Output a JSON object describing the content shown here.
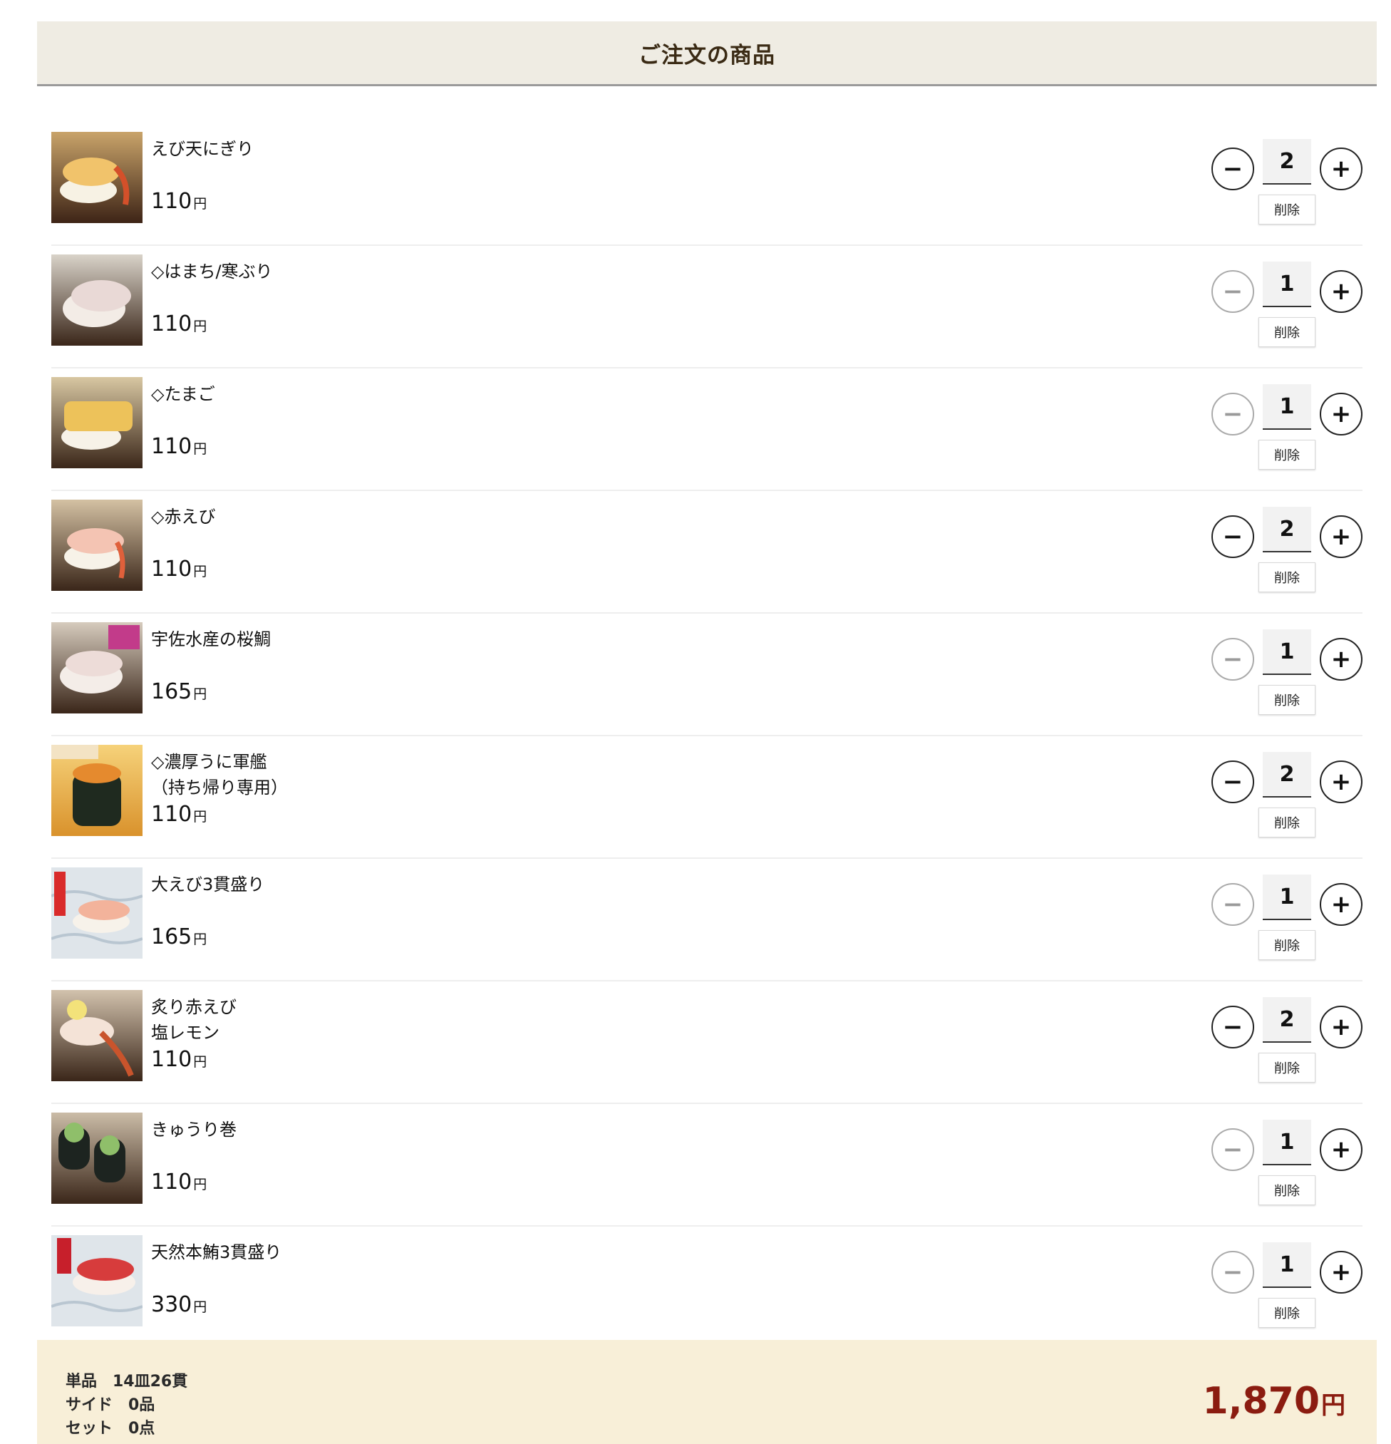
{
  "header": {
    "title": "ご注文の商品"
  },
  "currency_suffix": "円",
  "delete_label": "削除",
  "items": [
    {
      "name": "えび天にぎり",
      "price": "110",
      "qty": "2",
      "minus_enabled": true
    },
    {
      "name": "◇はまち/寒ぶり",
      "price": "110",
      "qty": "1",
      "minus_enabled": false
    },
    {
      "name": "◇たまご",
      "price": "110",
      "qty": "1",
      "minus_enabled": false
    },
    {
      "name": "◇赤えび",
      "price": "110",
      "qty": "2",
      "minus_enabled": true
    },
    {
      "name": "宇佐水産の桜鯛",
      "price": "165",
      "qty": "1",
      "minus_enabled": false
    },
    {
      "name": "◇濃厚うに軍艦\n（持ち帰り専用）",
      "price": "110",
      "qty": "2",
      "minus_enabled": true
    },
    {
      "name": "大えび3貫盛り",
      "price": "165",
      "qty": "1",
      "minus_enabled": false
    },
    {
      "name": "炙り赤えび\n塩レモン",
      "price": "110",
      "qty": "2",
      "minus_enabled": true
    },
    {
      "name": "きゅうり巻",
      "price": "110",
      "qty": "1",
      "minus_enabled": false
    },
    {
      "name": "天然本鮪3貫盛り",
      "price": "330",
      "qty": "1",
      "minus_enabled": false
    }
  ],
  "summary": {
    "single": "単品　14皿26貫",
    "side": "サイド　0品",
    "set": "セット　0点"
  },
  "total": {
    "amount": "1,870"
  },
  "colors": {
    "accent": "#8b1c10",
    "header_bg": "#efece3",
    "footer_bg": "#f8efd8"
  }
}
